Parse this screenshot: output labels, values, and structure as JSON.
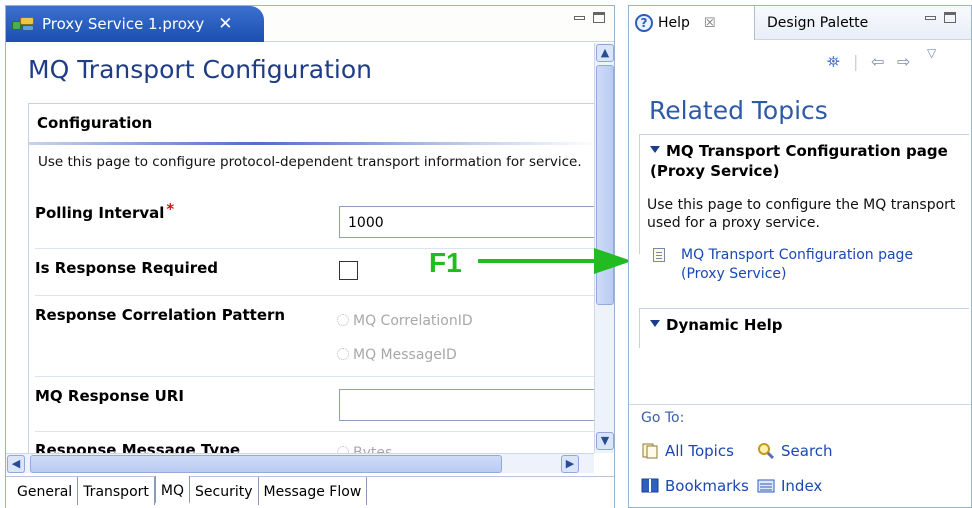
{
  "editor": {
    "tab_title": "Proxy Service 1.proxy",
    "tab_close": "✕",
    "page_title": "MQ Transport Configuration",
    "section_title": "Configuration",
    "description": "Use this page to configure protocol-dependent transport information for service.",
    "fields": {
      "polling_interval": {
        "label": "Polling Interval",
        "required_mark": "*",
        "value": "1000"
      },
      "is_response_required": {
        "label": "Is Response Required",
        "checked": false
      },
      "response_correlation_pattern": {
        "label": "Response Correlation Pattern",
        "options": [
          "MQ CorrelationID",
          "MQ MessageID"
        ]
      },
      "mq_response_uri": {
        "label": "MQ Response URI",
        "value": ""
      },
      "response_message_type": {
        "label": "Response Message Type",
        "option": "Bytes"
      }
    },
    "page_tabs": [
      "General",
      "Transport",
      "MQ",
      "Security",
      "Message Flow"
    ],
    "active_page_tab": "MQ"
  },
  "help": {
    "tab_title": "Help",
    "tab_close": "☒",
    "other_tab": "Design Palette",
    "related_topics_title": "Related Topics",
    "section1_title": "MQ Transport Configuration page (Proxy Service)",
    "section1_description": "Use this page to configure the MQ transport used for a proxy service.",
    "section1_link": "MQ Transport Configuration page (Proxy Service)",
    "section2_title": "Dynamic Help",
    "goto_label": "Go To:",
    "goto_items": {
      "all_topics": "All Topics",
      "search": "Search",
      "bookmarks": "Bookmarks",
      "index": "Index"
    }
  },
  "annotation": {
    "label": "F1",
    "color": "#22bb22"
  },
  "colors": {
    "title_blue": "#1f3c87",
    "link_blue": "#1a48b4",
    "tab_blue": "#2a5fc4",
    "required_red": "#d01010"
  }
}
